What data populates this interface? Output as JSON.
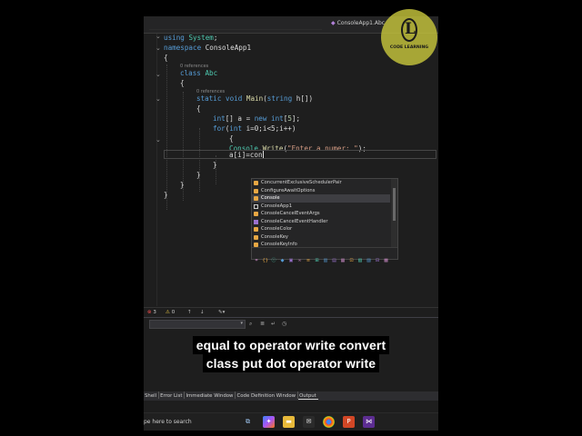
{
  "navigation": {
    "class_path": "ConsoleApp1.Abc"
  },
  "code": {
    "line1": {
      "kw": "using",
      "ns": "System",
      "semi": ";"
    },
    "line2": {
      "kw": "namespace",
      "name": "ConsoleApp1"
    },
    "brace_open": "{",
    "refs0": "0 references",
    "line_class": {
      "kw": "class",
      "name": "Abc"
    },
    "refs1": "0 references",
    "line_main": {
      "kw1": "static",
      "kw2": "void",
      "name": "Main",
      "open": "(",
      "kw3": "string",
      "rest": " h[])"
    },
    "line_arr": {
      "kw1": "int",
      "mid": "[] a = ",
      "kw2": "new",
      "kw3": "int",
      "bracket_open": "[",
      "num": "5",
      "bracket_close": "];"
    },
    "line_for": {
      "kw1": "for",
      "open": "(",
      "kw2": "int",
      "rest": " i=0;i<5;i++)"
    },
    "line_write": {
      "cls": "Console",
      "dot": ".",
      "method": "Write",
      "open": "(",
      "str": "\"Enter a numer: \"",
      "close": ");"
    },
    "line_assign": {
      "text": "a[i]=con"
    },
    "brace_close": "}"
  },
  "intellisense": {
    "items": [
      {
        "label": "ConcurrentExclusiveSchedulerPair",
        "icon": "class-icon"
      },
      {
        "label": "ConfigureAwaitOptions",
        "icon": "class-icon"
      },
      {
        "label": "Console",
        "icon": "class-icon"
      },
      {
        "label": "ConsoleApp1",
        "icon": "namespace-icon"
      },
      {
        "label": "ConsoleCancelEventArgs",
        "icon": "class-icon"
      },
      {
        "label": "ConsoleCancelEventHandler",
        "icon": "event-icon"
      },
      {
        "label": "ConsoleColor",
        "icon": "class-icon"
      },
      {
        "label": "ConsoleKey",
        "icon": "class-icon"
      },
      {
        "label": "ConsoleKeyInfo",
        "icon": "class-icon"
      }
    ],
    "selected_index": 2,
    "filters": [
      "⌗",
      "{}",
      "ⓘ",
      "◆",
      "▣",
      "∞",
      "≡",
      "⊞",
      "▥",
      "▤",
      "▦",
      "⊡",
      "▧",
      "▨",
      "⊟",
      "▩"
    ]
  },
  "status": {
    "errors": "3",
    "warnings": "0"
  },
  "caption": {
    "line1": "equal to operator write convert",
    "line2": "class put dot operator write"
  },
  "panel_tabs": [
    "Shell",
    "Error List",
    "Immediate Window",
    "Code Definition Window",
    "Output"
  ],
  "active_panel_tab": "Output",
  "taskbar": {
    "search_placeholder": "pe here to search"
  },
  "watermark": {
    "text": "CODE LEARNING",
    "letter": "L"
  }
}
